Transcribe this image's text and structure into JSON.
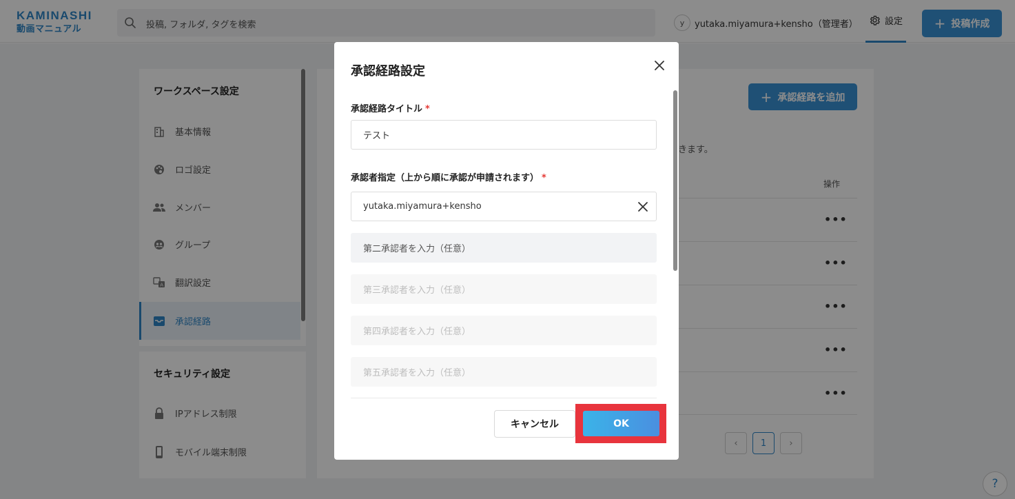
{
  "header": {
    "logo_line1": "KAMINASHI",
    "logo_line2": "動画マニュアル",
    "search_placeholder": "投稿, フォルダ, タグを検索",
    "avatar_initial": "y",
    "user_name": "yutaka.miyamura+kensho（管理者）",
    "settings_label": "設定",
    "post_button": "投稿作成"
  },
  "sidebar": {
    "workspace_heading": "ワークスペース設定",
    "items": [
      {
        "label": "基本情報",
        "icon": "building-icon"
      },
      {
        "label": "ロゴ設定",
        "icon": "palette-icon"
      },
      {
        "label": "メンバー",
        "icon": "people-icon"
      },
      {
        "label": "グループ",
        "icon": "group-icon"
      },
      {
        "label": "翻訳設定",
        "icon": "translate-icon"
      },
      {
        "label": "承認経路",
        "icon": "inbox-icon",
        "active": true
      }
    ],
    "security_heading": "セキュリティ設定",
    "security_items": [
      {
        "label": "IPアドレス制限",
        "icon": "lock-icon"
      },
      {
        "label": "モバイル端末制限",
        "icon": "mobile-icon"
      }
    ]
  },
  "content": {
    "add_route_button": "承認経路を追加",
    "description_tail": "きます。",
    "ops_header": "操作",
    "row_actions": "•••",
    "pagination": {
      "prev": "‹",
      "current": "1",
      "next": "›"
    }
  },
  "modal": {
    "title": "承認経路設定",
    "title_field_label": "承認経路タイトル",
    "required_mark": "*",
    "title_value": "テスト",
    "approver_label": "承認者指定（上から順に承認が申請されます）",
    "approver1": "yutaka.miyamura+kensho",
    "approver2_placeholder": "第二承認者を入力（任意）",
    "approver3_placeholder": "第三承認者を入力（任意）",
    "approver4_placeholder": "第四承認者を入力（任意）",
    "approver5_placeholder": "第五承認者を入力（任意）",
    "cancel_button": "キャンセル",
    "ok_button": "OK"
  },
  "help_label": "?",
  "colors": {
    "brand": "#2f86c7",
    "highlight": "#e8343d",
    "ok_gradient_start": "#3bb3e8",
    "ok_gradient_end": "#4a8fe0"
  }
}
